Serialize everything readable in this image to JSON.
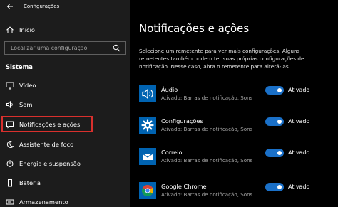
{
  "window": {
    "title": "Configurações"
  },
  "sidebar": {
    "home_label": "Início",
    "search_placeholder": "Localizar uma configuração",
    "section_label": "Sistema",
    "items": [
      {
        "label": "Vídeo",
        "icon": "monitor-icon"
      },
      {
        "label": "Som",
        "icon": "speaker-icon"
      },
      {
        "label": "Notificações e ações",
        "icon": "notification-icon",
        "selected": true
      },
      {
        "label": "Assistente de foco",
        "icon": "moon-icon"
      },
      {
        "label": "Energia e suspensão",
        "icon": "power-icon"
      },
      {
        "label": "Bateria",
        "icon": "battery-icon"
      },
      {
        "label": "Armazenamento",
        "icon": "storage-icon"
      }
    ]
  },
  "main": {
    "title": "Notificações e ações",
    "description": "Selecione um remetente para ver mais configurações. Alguns remetentes também podem ter suas próprias configurações de notificação. Nesse caso, abra o remetente para alterá-las.",
    "apps": [
      {
        "name": "Áudio",
        "subtitle": "Ativado: Barras de notificação, Sons",
        "state": "Ativado",
        "icon": "audio-icon",
        "icon_color": "#0063b1"
      },
      {
        "name": "Configurações",
        "subtitle": "Ativado: Barras de notificação, Sons",
        "state": "Ativado",
        "icon": "settings-gear-icon",
        "icon_color": "#0063b1"
      },
      {
        "name": "Correio",
        "subtitle": "Ativado: Barras de notificação, Sons",
        "state": "Ativado",
        "icon": "mail-icon",
        "icon_color": "#0063b1"
      },
      {
        "name": "Google Chrome",
        "subtitle": "Ativado: Barras de notificação, Sons",
        "state": "Ativado",
        "icon": "chrome-icon",
        "icon_color": "#0063b1"
      }
    ]
  },
  "colors": {
    "accent": "#1a70c8",
    "highlight_border": "#d9302d",
    "sidebar_bg": "#1c1c1c",
    "main_bg": "#000000"
  }
}
